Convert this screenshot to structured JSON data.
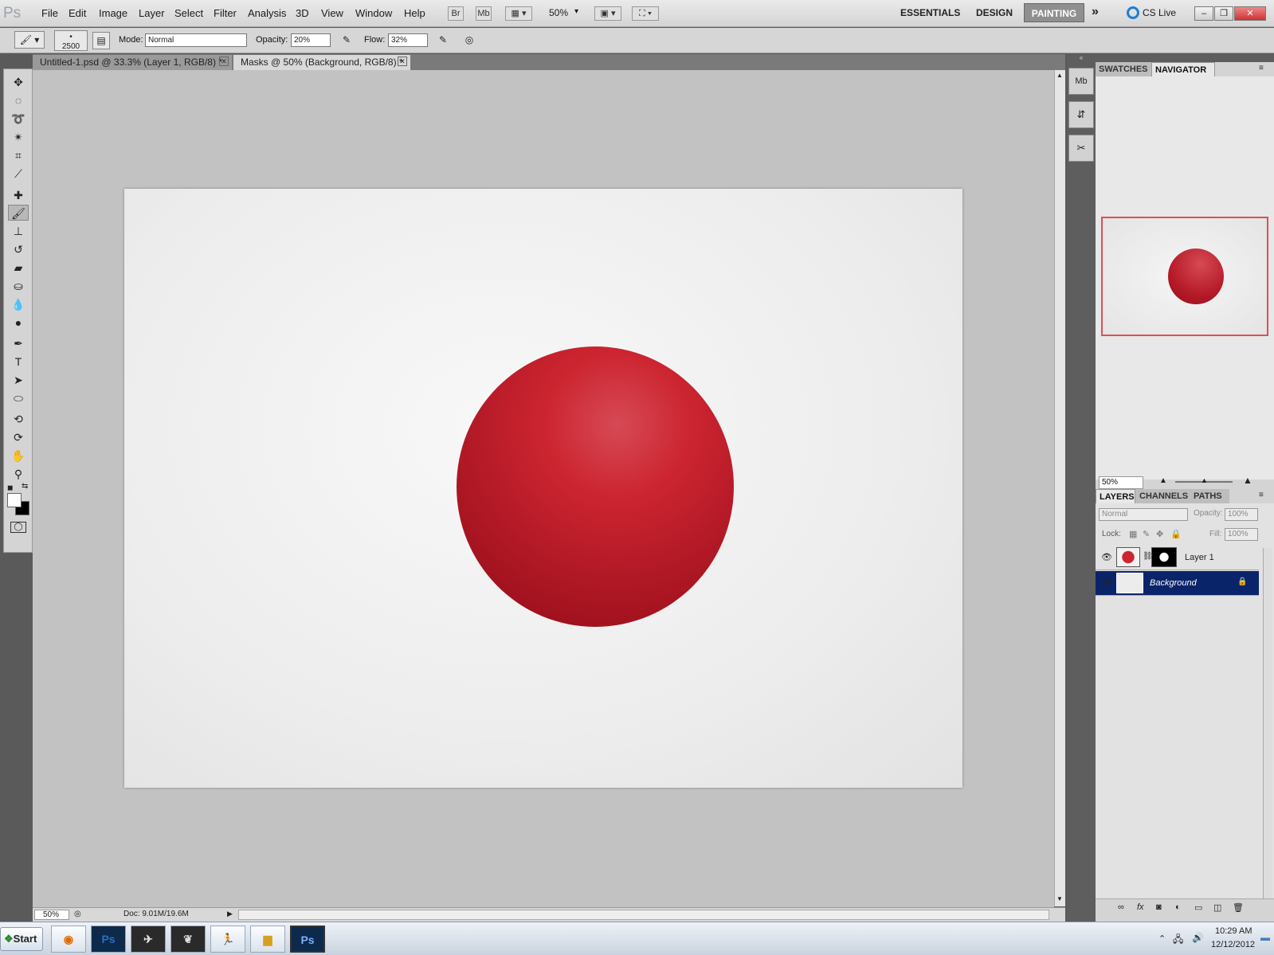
{
  "app": {
    "logo": "Ps"
  },
  "menu": [
    "File",
    "Edit",
    "Image",
    "Layer",
    "Select",
    "Filter",
    "Analysis",
    "3D",
    "View",
    "Window",
    "Help"
  ],
  "app_bar": {
    "bridge": "Br",
    "minibridge": "Mb",
    "zoom": "50%"
  },
  "workspaces": {
    "essentials": "ESSENTIALS",
    "design": "DESIGN",
    "painting": "PAINTING",
    "more": "»",
    "cs_live": "CS Live"
  },
  "window_controls": {
    "minimize": "–",
    "restore": "❐",
    "close": "✕"
  },
  "options": {
    "brush_size": "2500",
    "mode_label": "Mode:",
    "mode_value": "Normal",
    "opacity_label": "Opacity:",
    "opacity_value": "20%",
    "flow_label": "Flow:",
    "flow_value": "32%"
  },
  "documents": [
    {
      "title": "Untitled-1.psd @ 33.3% (Layer 1, RGB/8) *",
      "active": false
    },
    {
      "title": "Masks @ 50% (Background, RGB/8) *",
      "active": true
    }
  ],
  "tools": [
    "move-icon",
    "marquee-icon",
    "lasso-icon",
    "magic-wand-icon",
    "crop-icon",
    "eyedropper-icon",
    "healing-icon",
    "brush-icon",
    "stamp-icon",
    "history-brush-icon",
    "eraser-icon",
    "paint-bucket-icon",
    "blur-icon",
    "dodge-icon",
    "pen-icon",
    "type-icon",
    "path-select-icon",
    "ellipse-icon",
    "3d-rotate-icon",
    "3d-orbit-icon",
    "hand-icon",
    "zoom-icon"
  ],
  "status": {
    "zoom": "50%",
    "doc": "Doc: 9.01M/19.6M"
  },
  "navigator": {
    "tabs": [
      "SWATCHES",
      "NAVIGATOR"
    ],
    "active": "NAVIGATOR",
    "zoom": "50%"
  },
  "layers_panel": {
    "tabs": [
      "LAYERS",
      "CHANNELS",
      "PATHS"
    ],
    "active": "LAYERS",
    "blend_mode": "Normal",
    "opacity_label": "Opacity:",
    "opacity_value": "100%",
    "lock_label": "Lock:",
    "fill_label": "Fill:",
    "fill_value": "100%",
    "layers": [
      {
        "name": "Layer 1",
        "selected": false,
        "has_mask": true
      },
      {
        "name": "Background",
        "selected": true,
        "locked": true
      }
    ]
  },
  "taskbar": {
    "start": "Start",
    "time": "10:29 AM",
    "date": "12/12/2012",
    "apps": [
      "firefox-icon",
      "photoshop-icon",
      "app-icon",
      "app-icon",
      "zbrush-icon",
      "folder-icon",
      "photoshop-icon"
    ]
  },
  "colors": {
    "sphere": "#b51a27",
    "selected_layer": "#0a246a",
    "nav_frame": "#e05050"
  }
}
